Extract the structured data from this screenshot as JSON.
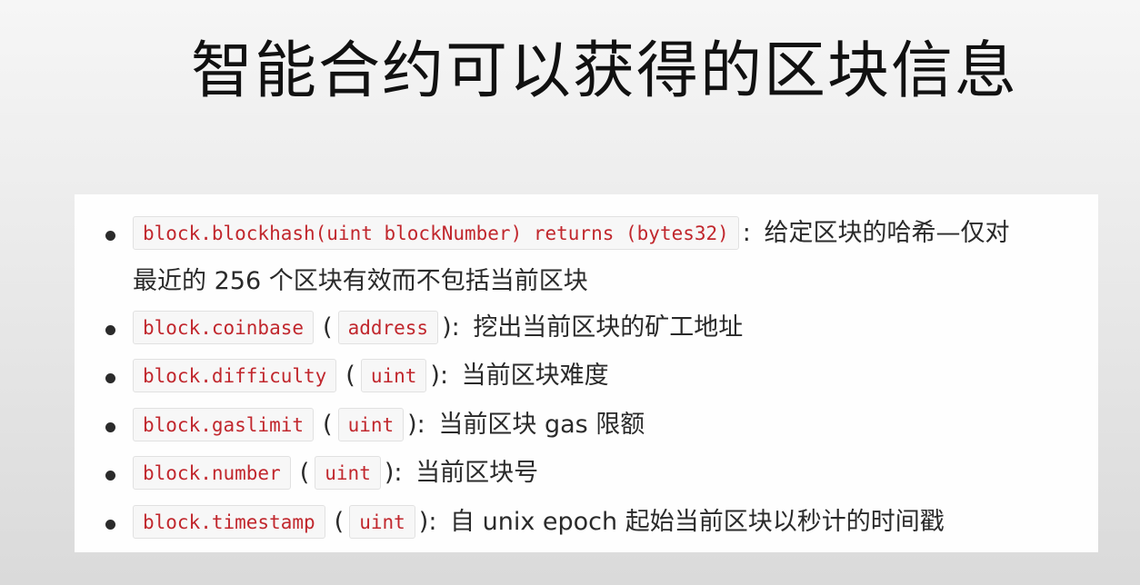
{
  "slide": {
    "title": "智能合约可以获得的区块信息"
  },
  "items": [
    {
      "code": "block.blockhash(uint blockNumber) returns (bytes32)",
      "separator": ":",
      "description_line1": "给定区块的哈希—仅对",
      "description_line2": "最近的 256 个区块有效而不包括当前区块"
    },
    {
      "code": "block.coinbase",
      "open_paren": "(",
      "type": "address",
      "close": "):",
      "description": "挖出当前区块的矿工地址"
    },
    {
      "code": "block.difficulty",
      "open_paren": "(",
      "type": "uint",
      "close": "):",
      "description": "当前区块难度"
    },
    {
      "code": "block.gaslimit",
      "open_paren": "(",
      "type": "uint",
      "close": "):",
      "description": "当前区块 gas 限额"
    },
    {
      "code": "block.number",
      "open_paren": "(",
      "type": "uint",
      "close": "):",
      "description": "当前区块号"
    },
    {
      "code": "block.timestamp",
      "open_paren": "(",
      "type": "uint",
      "close": "):",
      "description": "自 unix epoch 起始当前区块以秒计的时间戳"
    }
  ],
  "colors": {
    "code_text": "#c1272d",
    "code_background": "#f7f7f7",
    "body_text": "#2a2a2a"
  }
}
